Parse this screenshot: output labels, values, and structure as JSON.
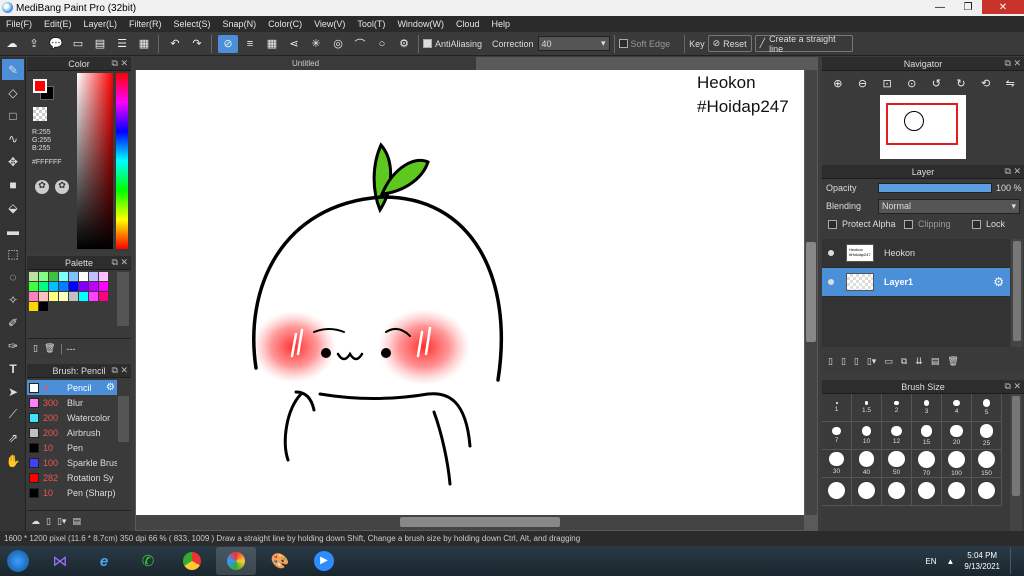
{
  "window": {
    "title": "MediBang Paint Pro (32bit)"
  },
  "menu": [
    "File(F)",
    "Edit(E)",
    "Layer(L)",
    "Filter(R)",
    "Select(S)",
    "Snap(N)",
    "Color(C)",
    "View(V)",
    "Tool(T)",
    "Window(W)",
    "Cloud",
    "Help"
  ],
  "toolbar": {
    "antialiasing_label": "AntiAliasing",
    "correction_label": "Correction",
    "correction_value": "40",
    "soft_edge_label": "Soft Edge",
    "key_label": "Key",
    "reset_label": "Reset",
    "straight_line_label": "Create a straight line"
  },
  "color_panel": {
    "title": "Color",
    "r": "R:255",
    "g": "G:255",
    "b": "B:255",
    "hex": "#FFFFFF",
    "fg_color": "#ff0000",
    "bg_color": "#000000"
  },
  "palette_panel": {
    "title": "Palette",
    "extra": "---",
    "swatches": [
      "#c0e0a0",
      "#80ff80",
      "#40c040",
      "#80ffff",
      "#80c0ff",
      "#ffffff",
      "#c0c0ff",
      "#ffc0ff",
      "#40ff40",
      "#00ff80",
      "#00c0ff",
      "#0080ff",
      "#0000ff",
      "#8000ff",
      "#c000ff",
      "#ff00ff",
      "#ff80c0",
      "#ffc0c0",
      "#ffff80",
      "#ffffc0",
      "#c0c0c0",
      "#00ffff",
      "#ff40ff",
      "#ff0080",
      "#ffd700",
      "#000000"
    ]
  },
  "brush_panel": {
    "title": "Brush: Pencil",
    "items": [
      {
        "size": "4",
        "name": "Pencil",
        "color": "#ffffff"
      },
      {
        "size": "300",
        "name": "Blur",
        "color": "#ff80ff"
      },
      {
        "size": "200",
        "name": "Watercolor",
        "color": "#40e0ff"
      },
      {
        "size": "200",
        "name": "Airbrush",
        "color": "#c0c0c0"
      },
      {
        "size": "10",
        "name": "Pen",
        "color": "#000000"
      },
      {
        "size": "100",
        "name": "Sparkle Brush",
        "color": "#4040ff"
      },
      {
        "size": "282",
        "name": "Rotation Sy",
        "color": "#ff0000"
      },
      {
        "size": "10",
        "name": "Pen (Sharp)",
        "color": "#000000"
      }
    ]
  },
  "document": {
    "tab": "Untitled",
    "text1": "Heokon",
    "text2": "#Hoidap247"
  },
  "navigator": {
    "title": "Navigator"
  },
  "layer_panel": {
    "title": "Layer",
    "opacity_label": "Opacity",
    "opacity_value": "100 %",
    "opacity": 1.0,
    "blending_label": "Blending",
    "blending_value": "Normal",
    "protect_alpha": "Protect Alpha",
    "clipping": "Clipping",
    "lock": "Lock",
    "layers": [
      {
        "name": "Heokon",
        "thumb": "Heokon #Hoidap247"
      },
      {
        "name": "Layer1"
      }
    ]
  },
  "brush_size_panel": {
    "title": "Brush Size",
    "sizes": [
      "1",
      "1.5",
      "2",
      "3",
      "4",
      "5",
      "7",
      "10",
      "12",
      "15",
      "20",
      "25",
      "30",
      "40",
      "50",
      "70",
      "100",
      "150",
      "",
      "",
      "",
      "",
      "",
      ""
    ]
  },
  "status": "1600 * 1200 pixel   (11.6 * 8.7cm)   350 dpi   66 %   ( 833, 1009 )   Draw a straight line by holding down Shift, Change a brush size by holding down Ctrl, Alt, and dragging",
  "taskbar": {
    "lang": "EN",
    "time": "5:04 PM",
    "date": "9/13/2021"
  }
}
